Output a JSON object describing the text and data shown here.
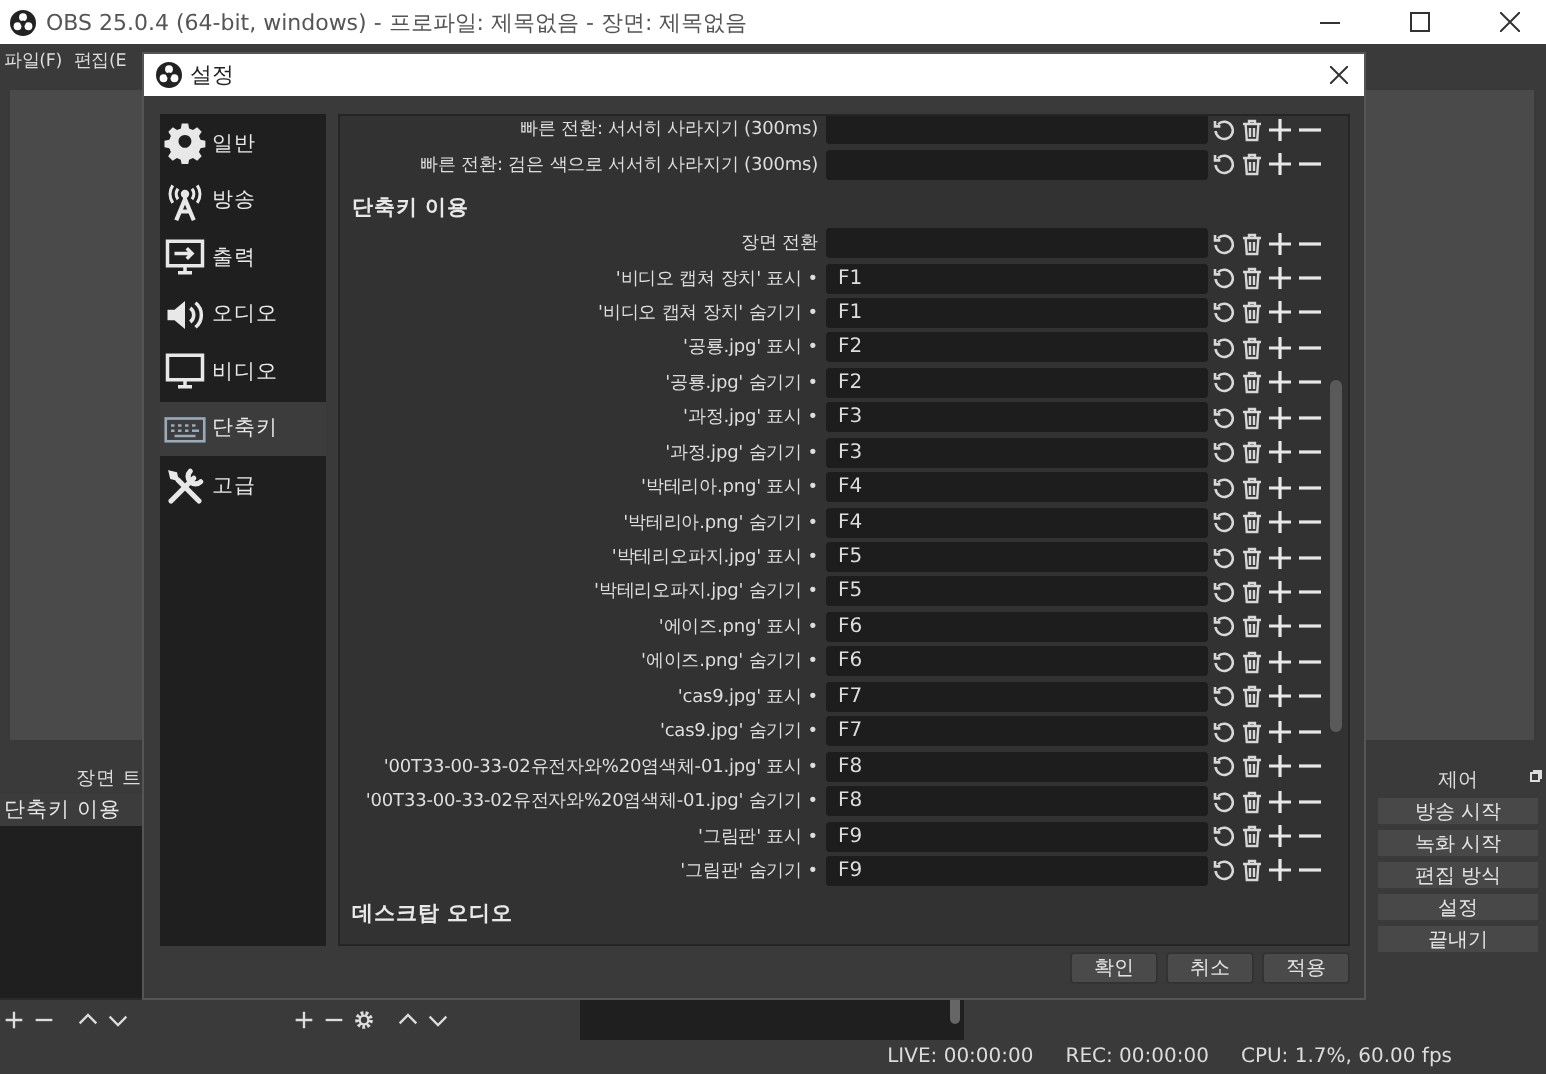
{
  "app_window": {
    "title": "OBS 25.0.4 (64-bit, windows) - 프로파일: 제목없음 - 장면: 제목없음"
  },
  "menu": [
    "파일(F)",
    "편집(E"
  ],
  "scenes_panel": {
    "title": "장면 트",
    "items": [
      {
        "label": "단축키 이용",
        "selected": true
      }
    ]
  },
  "controls_panel": {
    "title": "제어",
    "buttons": [
      "방송 시작",
      "녹화 시작",
      "편집 방식",
      "설정",
      "끝내기"
    ]
  },
  "status_bar": [
    "LIVE: 00:00:00",
    "REC: 00:00:00",
    "CPU: 1.7%, 60.00 fps"
  ],
  "dialog": {
    "title": "설정",
    "nav": [
      {
        "label": "일반",
        "selected": false
      },
      {
        "label": "방송",
        "selected": false
      },
      {
        "label": "출력",
        "selected": false
      },
      {
        "label": "오디오",
        "selected": false
      },
      {
        "label": "비디오",
        "selected": false
      },
      {
        "label": "단축키",
        "selected": true
      },
      {
        "label": "고급",
        "selected": false
      }
    ],
    "sections": [
      {
        "rows": [
          {
            "label": "빠른 전환: 서서히 사라지기 (300ms)"
          },
          {
            "label": "빠른 전환: 검은 색으로 서서히 사라지기 (300ms)"
          }
        ]
      },
      {
        "heading": "단축키 이용",
        "rows": [
          {
            "label": "장면 전환"
          },
          {
            "label": "'비디오 캡쳐 장치' 표시 •",
            "key": "F1"
          },
          {
            "label": "'비디오 캡쳐 장치' 숨기기 •",
            "key": "F1"
          },
          {
            "label": "'공룡.jpg' 표시 •",
            "key": "F2"
          },
          {
            "label": "'공룡.jpg' 숨기기 •",
            "key": "F2"
          },
          {
            "label": "'과정.jpg' 표시 •",
            "key": "F3"
          },
          {
            "label": "'과정.jpg' 숨기기 •",
            "key": "F3"
          },
          {
            "label": "'박테리아.png' 표시 •",
            "key": "F4"
          },
          {
            "label": "'박테리아.png' 숨기기 •",
            "key": "F4"
          },
          {
            "label": "'박테리오파지.jpg' 표시 •",
            "key": "F5"
          },
          {
            "label": "'박테리오파지.jpg' 숨기기 •",
            "key": "F5"
          },
          {
            "label": "'에이즈.png' 표시 •",
            "key": "F6"
          },
          {
            "label": "'에이즈.png' 숨기기 •",
            "key": "F6"
          },
          {
            "label": "'cas9.jpg' 표시 •",
            "key": "F7"
          },
          {
            "label": "'cas9.jpg' 숨기기 •",
            "key": "F7"
          },
          {
            "label": "'00T33-00-33-02유전자와%20염색체-01.jpg' 표시 •",
            "key": "F8"
          },
          {
            "label": "'00T33-00-33-02유전자와%20염색체-01.jpg' 숨기기 •",
            "key": "F8"
          },
          {
            "label": "'그림판' 표시 •",
            "key": "F9"
          },
          {
            "label": "'그림판' 숨기기 •",
            "key": "F9"
          }
        ]
      },
      {
        "heading": "데스크탑 오디오"
      }
    ],
    "buttons": [
      "확인",
      "취소",
      "적용"
    ]
  }
}
